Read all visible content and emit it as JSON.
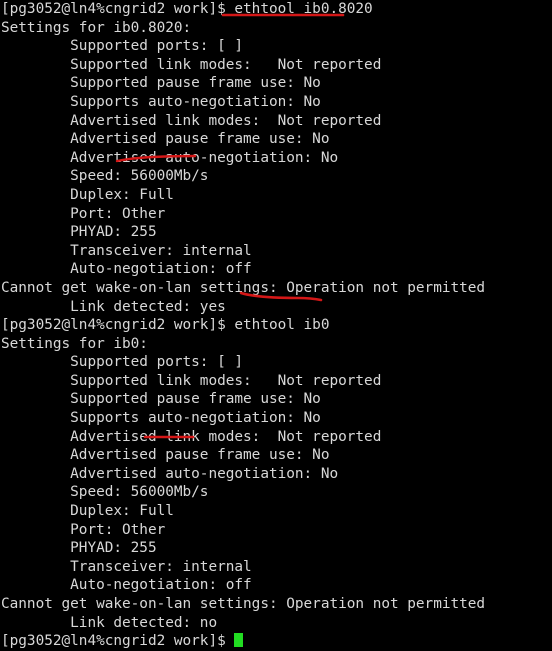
{
  "terminal": {
    "title": "Terminal",
    "background_color": "#000000",
    "text_color": "#d8d8d8",
    "cursor_color": "#22dd22",
    "annotation_color": "#d41717",
    "prompt": "[pg3052@ln4%cngrid2 work]$",
    "lines": [
      {
        "id": "l01",
        "kind": "command",
        "text": "[pg3052@ln4%cngrid2 work]$ ethtool ib0.8020"
      },
      {
        "id": "l02",
        "kind": "output",
        "text": "Settings for ib0.8020:"
      },
      {
        "id": "l03",
        "kind": "output",
        "text": "        Supported ports: [ ]"
      },
      {
        "id": "l04",
        "kind": "output",
        "text": "        Supported link modes:   Not reported"
      },
      {
        "id": "l05",
        "kind": "output",
        "text": "        Supported pause frame use: No"
      },
      {
        "id": "l06",
        "kind": "output",
        "text": "        Supports auto-negotiation: No"
      },
      {
        "id": "l07",
        "kind": "output",
        "text": "        Advertised link modes:  Not reported"
      },
      {
        "id": "l08",
        "kind": "output",
        "text": "        Advertised pause frame use: No"
      },
      {
        "id": "l09",
        "kind": "output",
        "text": "        Advertised auto-negotiation: No"
      },
      {
        "id": "l10",
        "kind": "output",
        "text": "        Speed: 56000Mb/s"
      },
      {
        "id": "l11",
        "kind": "output",
        "text": "        Duplex: Full"
      },
      {
        "id": "l12",
        "kind": "output",
        "text": "        Port: Other"
      },
      {
        "id": "l13",
        "kind": "output",
        "text": "        PHYAD: 255"
      },
      {
        "id": "l14",
        "kind": "output",
        "text": "        Transceiver: internal"
      },
      {
        "id": "l15",
        "kind": "output",
        "text": "        Auto-negotiation: off"
      },
      {
        "id": "l16",
        "kind": "error",
        "text": "Cannot get wake-on-lan settings: Operation not permitted"
      },
      {
        "id": "l17",
        "kind": "output",
        "text": "        Link detected: yes"
      },
      {
        "id": "l18",
        "kind": "command",
        "text": "[pg3052@ln4%cngrid2 work]$ ethtool ib0"
      },
      {
        "id": "l19",
        "kind": "output",
        "text": "Settings for ib0:"
      },
      {
        "id": "l20",
        "kind": "output",
        "text": "        Supported ports: [ ]"
      },
      {
        "id": "l21",
        "kind": "output",
        "text": "        Supported link modes:   Not reported"
      },
      {
        "id": "l22",
        "kind": "output",
        "text": "        Supported pause frame use: No"
      },
      {
        "id": "l23",
        "kind": "output",
        "text": "        Supports auto-negotiation: No"
      },
      {
        "id": "l24",
        "kind": "output",
        "text": "        Advertised link modes:  Not reported"
      },
      {
        "id": "l25",
        "kind": "output",
        "text": "        Advertised pause frame use: No"
      },
      {
        "id": "l26",
        "kind": "output",
        "text": "        Advertised auto-negotiation: No"
      },
      {
        "id": "l27",
        "kind": "output",
        "text": "        Speed: 56000Mb/s"
      },
      {
        "id": "l28",
        "kind": "output",
        "text": "        Duplex: Full"
      },
      {
        "id": "l29",
        "kind": "output",
        "text": "        Port: Other"
      },
      {
        "id": "l30",
        "kind": "output",
        "text": "        PHYAD: 255"
      },
      {
        "id": "l31",
        "kind": "output",
        "text": "        Transceiver: internal"
      },
      {
        "id": "l32",
        "kind": "output",
        "text": "        Auto-negotiation: off"
      },
      {
        "id": "l33",
        "kind": "error",
        "text": "Cannot get wake-on-lan settings: Operation not permitted"
      },
      {
        "id": "l34",
        "kind": "output",
        "text": "        Link detected: no"
      },
      {
        "id": "l35",
        "kind": "prompt",
        "text": "[pg3052@ln4%cngrid2 work]$ "
      }
    ],
    "commands": [
      {
        "id": "cmd1",
        "text": "ethtool ib0.8020",
        "interface": "ib0.8020"
      },
      {
        "id": "cmd2",
        "text": "ethtool ib0",
        "interface": "ib0"
      }
    ],
    "annotations": [
      {
        "id": "a1",
        "kind": "underline-straight",
        "target": "ethtool ib0.8020",
        "note": "red line under first command"
      },
      {
        "id": "a2",
        "kind": "underline-curve",
        "target": "56000Mb/s",
        "note": "red line under first Speed value"
      },
      {
        "id": "a3",
        "kind": "stroke-curve",
        "target": "ethtool ib0",
        "note": "red stroke below second command"
      },
      {
        "id": "a4",
        "kind": "underline-straight",
        "target": "56000Mb/s",
        "note": "red line under second Speed value"
      }
    ],
    "cursor": {
      "visible": true,
      "shape": "block"
    }
  }
}
